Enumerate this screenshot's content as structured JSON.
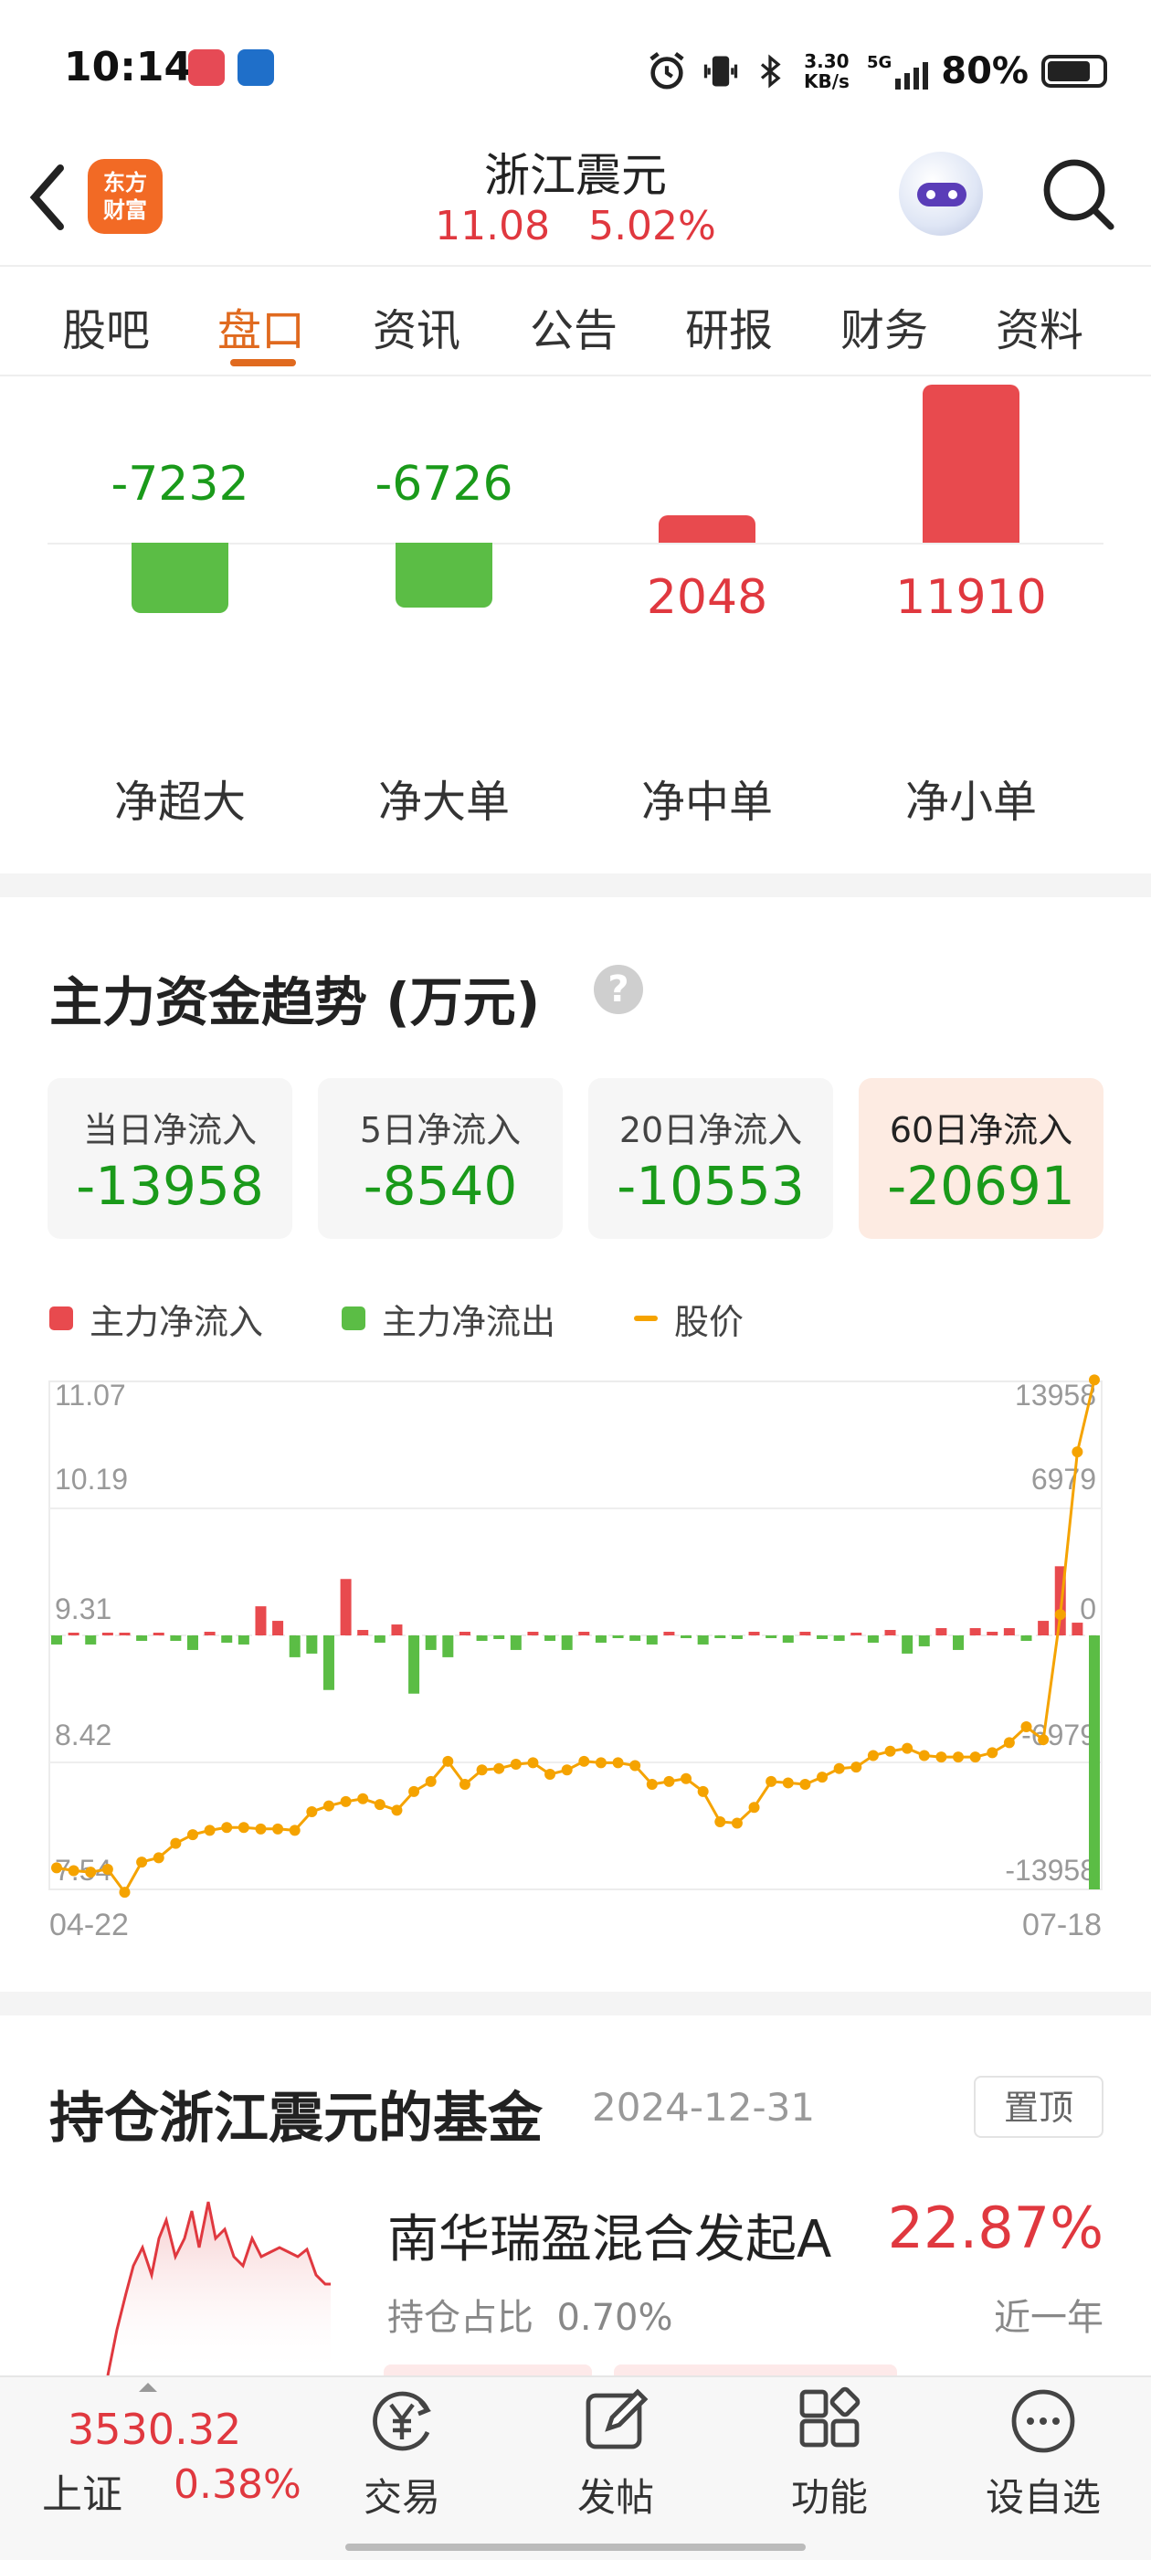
{
  "status_bar": {
    "time": "10:14",
    "network_speed": "3.30 KB/s",
    "network_type": "5G",
    "battery": "80%",
    "battery_level": 0.8,
    "icons": [
      "alarm-icon",
      "vibrate-icon",
      "bluetooth-icon",
      "signal-icon",
      "battery-icon"
    ]
  },
  "header": {
    "logo_line1": "东方",
    "logo_line2": "财富",
    "stock_name": "浙江震元",
    "price": "11.08",
    "change_pct": "5.02%",
    "accent_color": "#e0383f"
  },
  "tabs": [
    {
      "label": "股吧"
    },
    {
      "label": "盘口",
      "active": true
    },
    {
      "label": "资讯"
    },
    {
      "label": "公告"
    },
    {
      "label": "研报"
    },
    {
      "label": "财务"
    },
    {
      "label": "资料"
    }
  ],
  "order_flow": {
    "items": [
      {
        "label": "净超大",
        "value": -7232
      },
      {
        "label": "净大单",
        "value": -6726
      },
      {
        "label": "净中单",
        "value": 2048
      },
      {
        "label": "净小单",
        "value": 11910
      }
    ],
    "value_texts": [
      "-7232",
      "-6726",
      "2048",
      "11910"
    ],
    "positive_color": "#e84a4e",
    "negative_color": "#5bbd45"
  },
  "main_flow": {
    "title": "主力资金趋势 (万元)",
    "help_icon": "?",
    "cards": [
      {
        "label": "当日净流入",
        "value": "-13958"
      },
      {
        "label": "5日净流入",
        "value": "-8540"
      },
      {
        "label": "20日净流入",
        "value": "-10553"
      },
      {
        "label": "60日净流入",
        "value": "-20691",
        "active": true
      }
    ],
    "legend": {
      "inflow": "主力净流入",
      "outflow": "主力净流出",
      "price": "股价"
    }
  },
  "chart_data": {
    "type": "bar",
    "left_axis_ticks": [
      "11.07",
      "10.19",
      "9.31",
      "8.42",
      "7.54"
    ],
    "right_axis_ticks": [
      "13958",
      "6979",
      "0",
      "-6979",
      "-13958"
    ],
    "price_range": [
      7.54,
      11.07
    ],
    "flow_range": [
      -13958,
      13958
    ],
    "x_labels": [
      "04-22",
      "07-18"
    ],
    "series": [
      {
        "name": "主力净流入 / 主力净流出",
        "type": "bar",
        "values": [
          -500,
          150,
          -500,
          100,
          120,
          -300,
          150,
          -300,
          -800,
          200,
          -400,
          -500,
          1600,
          800,
          -1200,
          -1000,
          -3000,
          3100,
          300,
          -400,
          600,
          -3200,
          -800,
          -1200,
          200,
          -300,
          -200,
          -800,
          200,
          -300,
          -800,
          200,
          -400,
          -100,
          -300,
          -500,
          200,
          -100,
          -500,
          -100,
          -200,
          200,
          -100,
          -400,
          200,
          -200,
          -300,
          100,
          -400,
          300,
          -1000,
          -600,
          400,
          -800,
          400,
          200,
          400,
          -300,
          800,
          3800,
          700,
          -13958
        ]
      },
      {
        "name": "股价",
        "type": "line",
        "values": [
          7.69,
          7.67,
          7.66,
          7.68,
          7.52,
          7.73,
          7.76,
          7.86,
          7.92,
          7.95,
          7.97,
          7.97,
          7.96,
          7.96,
          7.95,
          8.08,
          8.12,
          8.15,
          8.17,
          8.13,
          8.09,
          8.22,
          8.29,
          8.43,
          8.27,
          8.37,
          8.38,
          8.41,
          8.42,
          8.34,
          8.37,
          8.43,
          8.42,
          8.42,
          8.4,
          8.27,
          8.29,
          8.31,
          8.22,
          8.01,
          8.0,
          8.11,
          8.29,
          8.28,
          8.27,
          8.32,
          8.38,
          8.39,
          8.47,
          8.5,
          8.52,
          8.47,
          8.46,
          8.46,
          8.46,
          8.49,
          8.56,
          8.67,
          8.58,
          9.45,
          10.58,
          11.08
        ]
      }
    ],
    "inflow_color": "#e84a4e",
    "outflow_color": "#5bbd45",
    "price_color": "#f5a300",
    "grid": true
  },
  "funds": {
    "title": "持仓浙江震元的基金",
    "date": "2024-12-31",
    "pin_label": "置顶",
    "items": [
      {
        "name": "南华瑞盈混合发起A",
        "return": "22.87%",
        "hold_label": "持仓占比",
        "hold_value": "0.70%",
        "period": "近一年"
      }
    ]
  },
  "bottom_nav": {
    "index_value": "3530.32",
    "index_name": "上证",
    "index_change": "0.38%",
    "items": [
      {
        "label": "交易",
        "icon": "trade-yen-icon"
      },
      {
        "label": "发帖",
        "icon": "post-edit-icon"
      },
      {
        "label": "功能",
        "icon": "grid-icon"
      },
      {
        "label": "设自选",
        "icon": "more-dots-icon"
      }
    ]
  }
}
